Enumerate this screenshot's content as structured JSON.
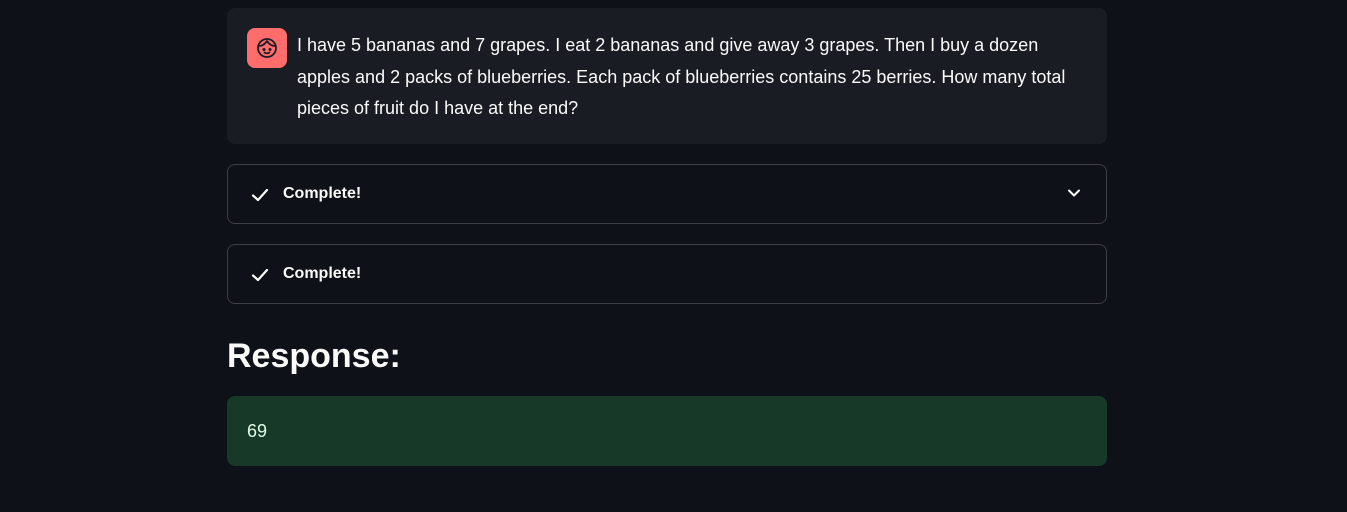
{
  "chat": {
    "avatar_icon": "user-face-icon",
    "avatar_color": "#ff6c6c",
    "message": "I have 5 bananas and 7 grapes. I eat 2 bananas and give away 3 grapes. Then I buy a dozen apples and 2 packs of blueberries. Each pack of blueberries contains 25 berries. How many total pieces of fruit do I have at the end?"
  },
  "status_items": [
    {
      "label": "Complete!",
      "icon": "check-icon",
      "expandable": true,
      "toggle_icon": "chevron-down-icon"
    },
    {
      "label": "Complete!",
      "icon": "check-icon",
      "expandable": false
    }
  ],
  "response": {
    "heading": "Response:",
    "value": "69",
    "box_color": "#173928",
    "text_color": "#dffde9"
  },
  "colors": {
    "background": "#0e1117",
    "chat_background": "#1a1c24",
    "text": "#fafafa"
  }
}
